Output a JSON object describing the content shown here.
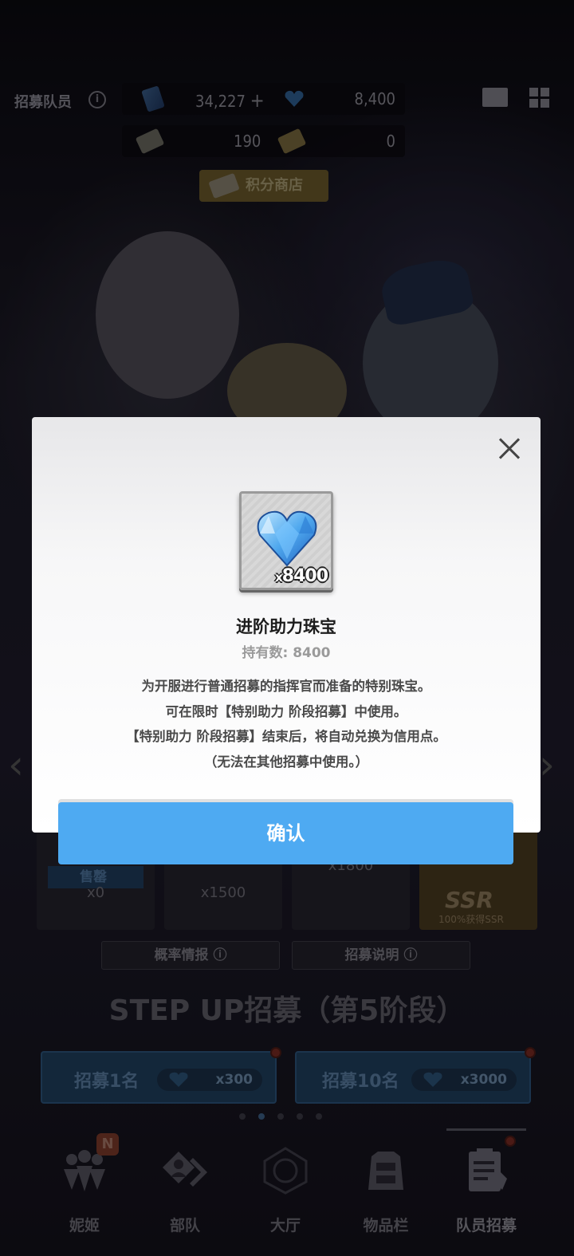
{
  "header": {
    "title": "招募队员",
    "gem_count": "34,227",
    "gem_plus": "+",
    "heart_gem_count": "8,400",
    "ticket_normal_count": "190",
    "ticket_gold_count": "0",
    "shop_label": "积分商店"
  },
  "step_cards": [
    {
      "label": "售罄",
      "qty": "x0"
    },
    {
      "label": "",
      "qty": "x1500"
    },
    {
      "label": "",
      "qty": "x1800"
    },
    {
      "label": "SSR",
      "sub": "100%获得SSR"
    }
  ],
  "lower": {
    "probability_label": "概率情报",
    "info_label": "招募说明",
    "step_title": "STEP UP招募（第5阶段）",
    "gacha_1_label": "招募1名",
    "gacha_1_cost": "x300",
    "gacha_10_label": "招募10名",
    "gacha_10_cost": "x3000"
  },
  "nav": [
    {
      "label": "妮姬"
    },
    {
      "label": "部队"
    },
    {
      "label": "大厅"
    },
    {
      "label": "物品栏"
    },
    {
      "label": "队员招募"
    }
  ],
  "nav_badge": "N",
  "modal": {
    "item_count_prefix": "x",
    "item_count": "8400",
    "title": "进阶助力珠宝",
    "owned": "持有数: 8400",
    "desc_lines": [
      "为开服进行普通招募的指挥官而准备的特别珠宝。",
      "可在限时【特别助力 阶段招募】中使用。",
      "【特别助力 阶段招募】结束后，将自动兑换为信用点。",
      "（无法在其他招募中使用。）"
    ],
    "confirm_label": "确认"
  },
  "colors": {
    "confirm_button": "#4eaaf2",
    "modal_background": "#ffffff",
    "gem_blue": "#4fa8ee"
  },
  "icons": [
    "info-icon",
    "gem-icon",
    "heart-gem-icon",
    "ticket-icon",
    "mail-icon",
    "grid-menu-icon",
    "close-icon",
    "chevron-left-icon",
    "chevron-right-icon"
  ]
}
